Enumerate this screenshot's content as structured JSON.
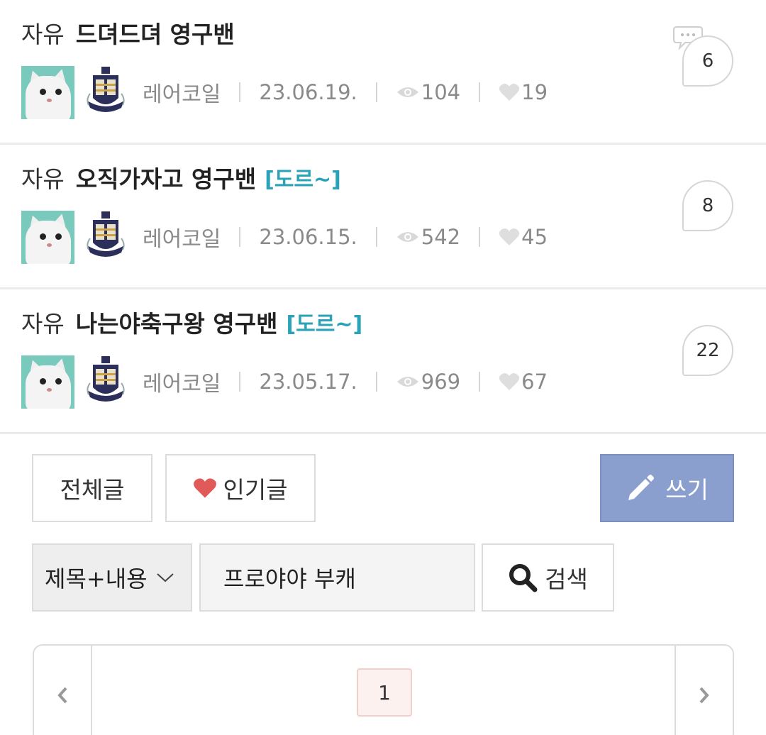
{
  "posts": [
    {
      "category": "자유",
      "title": "드뎌드뎌 영구밴",
      "tag": "",
      "author": "레어코일",
      "date": "23.06.19.",
      "views": "104",
      "likes": "19",
      "comments": "6"
    },
    {
      "category": "자유",
      "title": "오직가자고 영구밴",
      "tag": "[도르~]",
      "author": "레어코일",
      "date": "23.06.15.",
      "views": "542",
      "likes": "45",
      "comments": "8"
    },
    {
      "category": "자유",
      "title": "나는야축구왕 영구밴",
      "tag": "[도르~]",
      "author": "레어코일",
      "date": "23.05.17.",
      "views": "969",
      "likes": "67",
      "comments": "22"
    }
  ],
  "toolbar": {
    "all_label": "전체글",
    "popular_label": "인기글",
    "write_label": "쓰기"
  },
  "search": {
    "scope": "제목+내용",
    "query": "프로야야 부캐",
    "button_label": "검색"
  },
  "pagination": {
    "current_page": "1"
  },
  "colors": {
    "tag": "#2aa3b8",
    "write_button": "#8b9fcf",
    "heart": "#e05a5a"
  }
}
